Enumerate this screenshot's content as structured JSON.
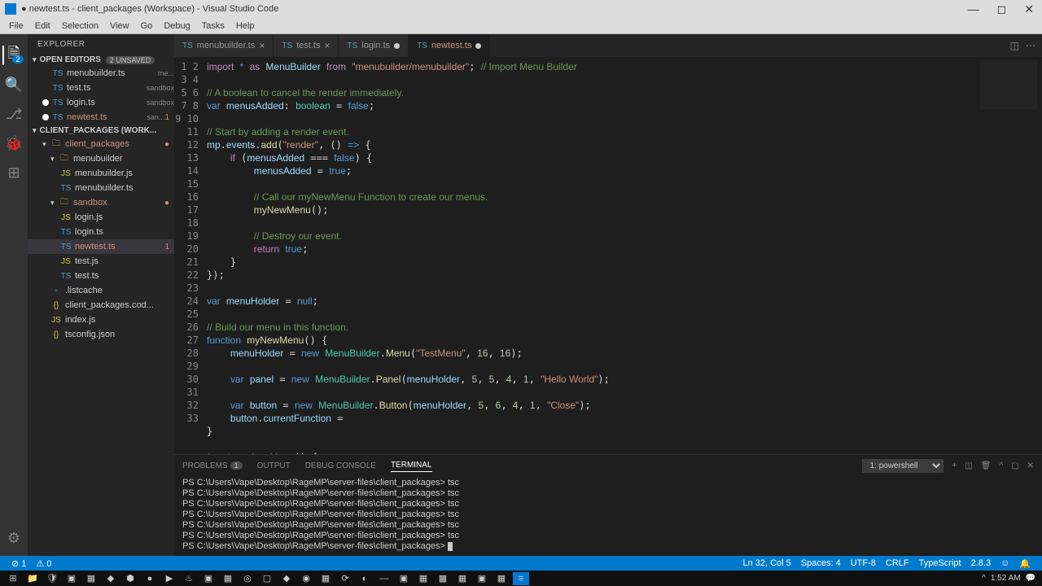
{
  "window": {
    "title": "● newtest.ts - client_packages (Workspace) - Visual Studio Code"
  },
  "menubar": [
    "File",
    "Edit",
    "Selection",
    "View",
    "Go",
    "Debug",
    "Tasks",
    "Help"
  ],
  "activitybar": {
    "explorer_badge": "2"
  },
  "sidebar": {
    "title": "EXPLORER",
    "open_editors": {
      "label": "Open Editors",
      "unsaved": "2 UNSAVED",
      "items": [
        {
          "label": "menubuilder.ts",
          "desc": "me...",
          "icon": "ts",
          "dirty": false
        },
        {
          "label": "test.ts",
          "desc": "sandbox",
          "icon": "ts",
          "dirty": false
        },
        {
          "label": "login.ts",
          "desc": "sandbox",
          "icon": "ts",
          "dirty": true,
          "dot": true
        },
        {
          "label": "newtest.ts",
          "desc": "san...",
          "icon": "ts",
          "dirty": true,
          "dot": true,
          "mark": "1",
          "color": "dirty"
        }
      ]
    },
    "workspace": {
      "label": "CLIENT_PACKAGES (WORK...",
      "tree": [
        {
          "type": "folder",
          "label": "client_packages",
          "indent": 0,
          "open": true,
          "dirty": true,
          "mark": "●"
        },
        {
          "type": "folder",
          "label": "menubuilder",
          "indent": 1,
          "open": true
        },
        {
          "type": "file",
          "label": "menubuilder.js",
          "indent": 2,
          "icon": "js"
        },
        {
          "type": "file",
          "label": "menubuilder.ts",
          "indent": 2,
          "icon": "ts"
        },
        {
          "type": "folder",
          "label": "sandbox",
          "indent": 1,
          "open": true,
          "dirty": true,
          "mark": "●"
        },
        {
          "type": "file",
          "label": "login.js",
          "indent": 2,
          "icon": "js"
        },
        {
          "type": "file",
          "label": "login.ts",
          "indent": 2,
          "icon": "ts"
        },
        {
          "type": "file",
          "label": "newtest.ts",
          "indent": 2,
          "icon": "ts",
          "dirty": true,
          "selected": true,
          "mark": "1"
        },
        {
          "type": "file",
          "label": "test.js",
          "indent": 2,
          "icon": "js"
        },
        {
          "type": "file",
          "label": "test.ts",
          "indent": 2,
          "icon": "ts"
        },
        {
          "type": "file",
          "label": ".listcache",
          "indent": 1,
          "icon": "file"
        },
        {
          "type": "file",
          "label": "client_packages.cod...",
          "indent": 1,
          "icon": "json"
        },
        {
          "type": "file",
          "label": "index.js",
          "indent": 1,
          "icon": "js"
        },
        {
          "type": "file",
          "label": "tsconfig.json",
          "indent": 1,
          "icon": "json"
        }
      ]
    }
  },
  "tabs": [
    {
      "label": "menubuilder.ts",
      "icon": "ts"
    },
    {
      "label": "test.ts",
      "icon": "ts"
    },
    {
      "label": "login.ts",
      "icon": "ts",
      "dot": true
    },
    {
      "label": "newtest.ts",
      "icon": "ts",
      "active": true,
      "dirty": true,
      "dot": true
    }
  ],
  "code": {
    "lines": [
      {
        "n": 1,
        "html": "<span class='ctrl'>import</span> <span class='kw'>*</span> <span class='ctrl'>as</span> <span class='vr'>MenuBuilder</span> <span class='ctrl'>from</span> <span class='str'>\"menubuilder/menubuilder\"</span>; <span class='cmt'>// Import Menu Builder</span>"
      },
      {
        "n": 2,
        "html": ""
      },
      {
        "n": 3,
        "html": "<span class='cmt'>// A boolean to cancel the render immediately.</span>"
      },
      {
        "n": 4,
        "html": "<span class='kw'>var</span> <span class='vr'>menusAdded</span>: <span class='cls'>boolean</span> = <span class='bool'>false</span>;"
      },
      {
        "n": 5,
        "html": ""
      },
      {
        "n": 6,
        "html": "<span class='cmt'>// Start by adding a render event.</span>"
      },
      {
        "n": 7,
        "html": "<span class='vr'>mp</span>.<span class='vr'>events</span>.<span class='fn'>add</span>(<span class='str'>\"render\"</span>, () <span class='kw'>=&gt;</span> {"
      },
      {
        "n": 8,
        "html": "    <span class='ctrl'>if</span> (<span class='vr'>menusAdded</span> === <span class='bool'>false</span>) {"
      },
      {
        "n": 9,
        "html": "        <span class='vr'>menusAdded</span> = <span class='bool'>true</span>;"
      },
      {
        "n": 10,
        "html": ""
      },
      {
        "n": 11,
        "html": "        <span class='cmt'>// Call our myNewMenu Function to create our menus.</span>"
      },
      {
        "n": 12,
        "html": "        <span class='fn'>myNewMenu</span>();"
      },
      {
        "n": 13,
        "html": ""
      },
      {
        "n": 14,
        "html": "        <span class='cmt'>// Destroy our event.</span>"
      },
      {
        "n": 15,
        "html": "        <span class='ctrl'>return</span> <span class='bool'>true</span>;"
      },
      {
        "n": 16,
        "html": "    }"
      },
      {
        "n": 17,
        "html": "});"
      },
      {
        "n": 18,
        "html": ""
      },
      {
        "n": 19,
        "html": "<span class='kw'>var</span> <span class='vr'>menuHolder</span> = <span class='bool'>null</span>;"
      },
      {
        "n": 20,
        "html": ""
      },
      {
        "n": 21,
        "html": "<span class='cmt'>// Build our menu in this function.</span>"
      },
      {
        "n": 22,
        "html": "<span class='kw'>function</span> <span class='fn'>myNewMenu</span>() {"
      },
      {
        "n": 23,
        "html": "    <span class='vr'>menuHolder</span> = <span class='kw'>new</span> <span class='cls'>MenuBuilder</span>.<span class='fn'>Menu</span>(<span class='str'>\"TestMenu\"</span>, <span class='num'>16</span>, <span class='num'>16</span>);"
      },
      {
        "n": 24,
        "html": ""
      },
      {
        "n": 25,
        "html": "    <span class='kw'>var</span> <span class='vr'>panel</span> = <span class='kw'>new</span> <span class='cls'>MenuBuilder</span>.<span class='fn'>Panel</span>(<span class='vr'>menuHolder</span>, <span class='num'>5</span>, <span class='num'>5</span>, <span class='num'>4</span>, <span class='num'>1</span>, <span class='str'>\"Hello World\"</span>);"
      },
      {
        "n": 26,
        "html": ""
      },
      {
        "n": 27,
        "html": "    <span class='kw'>var</span> <span class='vr'>button</span> = <span class='kw'>new</span> <span class='cls'>MenuBuilder</span>.<span class='fn'>Button</span>(<span class='vr'>menuHolder</span>, <span class='num'>5</span>, <span class='num'>6</span>, <span class='num'>4</span>, <span class='num'>1</span>, <span class='str'>\"Close\"</span>);"
      },
      {
        "n": 28,
        "html": "    <span class='vr'>button</span>.<span class='vr'>currentFunction</span> ="
      },
      {
        "n": 29,
        "html": "}"
      },
      {
        "n": 30,
        "html": ""
      },
      {
        "n": 31,
        "html": "<span class='kw'>function</span> <span class='fn'>closeMenu</span>() {"
      },
      {
        "n": 32,
        "html": "    "
      },
      {
        "n": 33,
        "html": "}"
      }
    ]
  },
  "panel": {
    "tabs": {
      "problems": "PROBLEMS",
      "problems_badge": "1",
      "output": "OUTPUT",
      "debug": "DEBUG CONSOLE",
      "terminal": "TERMINAL"
    },
    "term_select": "1: powershell",
    "lines": [
      "PS C:\\Users\\Vape\\Desktop\\RageMP\\server-files\\client_packages> tsc",
      "PS C:\\Users\\Vape\\Desktop\\RageMP\\server-files\\client_packages> tsc",
      "PS C:\\Users\\Vape\\Desktop\\RageMP\\server-files\\client_packages> tsc",
      "PS C:\\Users\\Vape\\Desktop\\RageMP\\server-files\\client_packages> tsc",
      "PS C:\\Users\\Vape\\Desktop\\RageMP\\server-files\\client_packages> tsc",
      "PS C:\\Users\\Vape\\Desktop\\RageMP\\server-files\\client_packages> tsc",
      "PS C:\\Users\\Vape\\Desktop\\RageMP\\server-files\\client_packages> "
    ]
  },
  "statusbar": {
    "left": [
      {
        "t": "⊘ 1"
      },
      {
        "t": "⚠ 0"
      }
    ],
    "right": [
      {
        "t": "Ln 32, Col 5"
      },
      {
        "t": "Spaces: 4"
      },
      {
        "t": "UTF-8"
      },
      {
        "t": "CRLF"
      },
      {
        "t": "TypeScript"
      },
      {
        "t": "2.8.3"
      },
      {
        "t": "☺"
      },
      {
        "t": "🔔"
      }
    ]
  },
  "taskbar": {
    "time": "1:52 AM"
  }
}
